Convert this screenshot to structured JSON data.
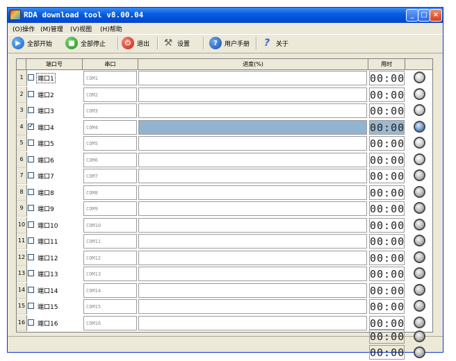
{
  "window": {
    "title": "RDA download tool v8.00.04",
    "controls": {
      "minimize": "_",
      "maximize": "□",
      "close": "×"
    }
  },
  "menu": [
    "(O)操作",
    "(M)管理",
    "(V)视图",
    "(H)帮助"
  ],
  "toolbar": {
    "start_all": "全部开始",
    "stop_all": "全部停止",
    "exit": "退出",
    "settings": "设置",
    "manual": "用户手册",
    "about": "关于"
  },
  "icons": {
    "start_all": "play-circle-icon",
    "stop_all": "stop-square-icon",
    "exit": "power-icon",
    "settings": "wrench-icon",
    "manual": "help-icon",
    "about": "question-icon",
    "status": "status-lamp-icon"
  },
  "colors": {
    "titlebar": "#0a5fe0",
    "selection": "#93b4d0",
    "window_bg": "#ece9d8"
  },
  "grid": {
    "headers": {
      "port": "端口号",
      "serial": "串口",
      "progress": "进度(%)",
      "time": "用时"
    },
    "rows": [
      {
        "num": "1",
        "checked": false,
        "name": "端口1",
        "com": "COM1",
        "time": "00:00",
        "status": "idle",
        "progress": 0
      },
      {
        "num": "2",
        "checked": false,
        "name": "端口2",
        "com": "COM2",
        "time": "00:00",
        "status": "idle",
        "progress": 0
      },
      {
        "num": "3",
        "checked": false,
        "name": "端口3",
        "com": "COM3",
        "time": "00:00",
        "status": "idle",
        "progress": 0
      },
      {
        "num": "4",
        "checked": true,
        "name": "端口4",
        "com": "COM4",
        "time": "00:00",
        "status": "active",
        "progress": 100
      },
      {
        "num": "5",
        "checked": false,
        "name": "端口5",
        "com": "COM5",
        "time": "00:00",
        "status": "idle",
        "progress": 0
      },
      {
        "num": "6",
        "checked": false,
        "name": "端口6",
        "com": "COM6",
        "time": "00:00",
        "status": "idle",
        "progress": 0
      },
      {
        "num": "7",
        "checked": false,
        "name": "端口7",
        "com": "COM7",
        "time": "00:00",
        "status": "dark",
        "progress": 0
      },
      {
        "num": "8",
        "checked": false,
        "name": "端口8",
        "com": "COM8",
        "time": "00:00",
        "status": "dark",
        "progress": 0
      },
      {
        "num": "9",
        "checked": false,
        "name": "端口9",
        "com": "COM9",
        "time": "00:00",
        "status": "dark",
        "progress": 0
      },
      {
        "num": "10",
        "checked": false,
        "name": "端口10",
        "com": "COM10",
        "time": "00:00",
        "status": "dark",
        "progress": 0
      },
      {
        "num": "11",
        "checked": false,
        "name": "端口11",
        "com": "COM11",
        "time": "00:00",
        "status": "dark",
        "progress": 0
      },
      {
        "num": "12",
        "checked": false,
        "name": "端口12",
        "com": "COM12",
        "time": "00:00",
        "status": "dark",
        "progress": 0
      },
      {
        "num": "13",
        "checked": false,
        "name": "端口13",
        "com": "COM13",
        "time": "00:00",
        "status": "dark",
        "progress": 0
      },
      {
        "num": "14",
        "checked": false,
        "name": "端口14",
        "com": "COM14",
        "time": "00:00",
        "status": "dark",
        "progress": 0
      },
      {
        "num": "15",
        "checked": false,
        "name": "端口15",
        "com": "COM15",
        "time": "00:00",
        "status": "dark",
        "progress": 0
      },
      {
        "num": "16",
        "checked": false,
        "name": "端口16",
        "com": "COM16",
        "time": "00:00",
        "status": "dark",
        "progress": 0
      }
    ],
    "overflow_rows": [
      {
        "time": "00:00"
      },
      {
        "time": "00:00"
      }
    ]
  }
}
